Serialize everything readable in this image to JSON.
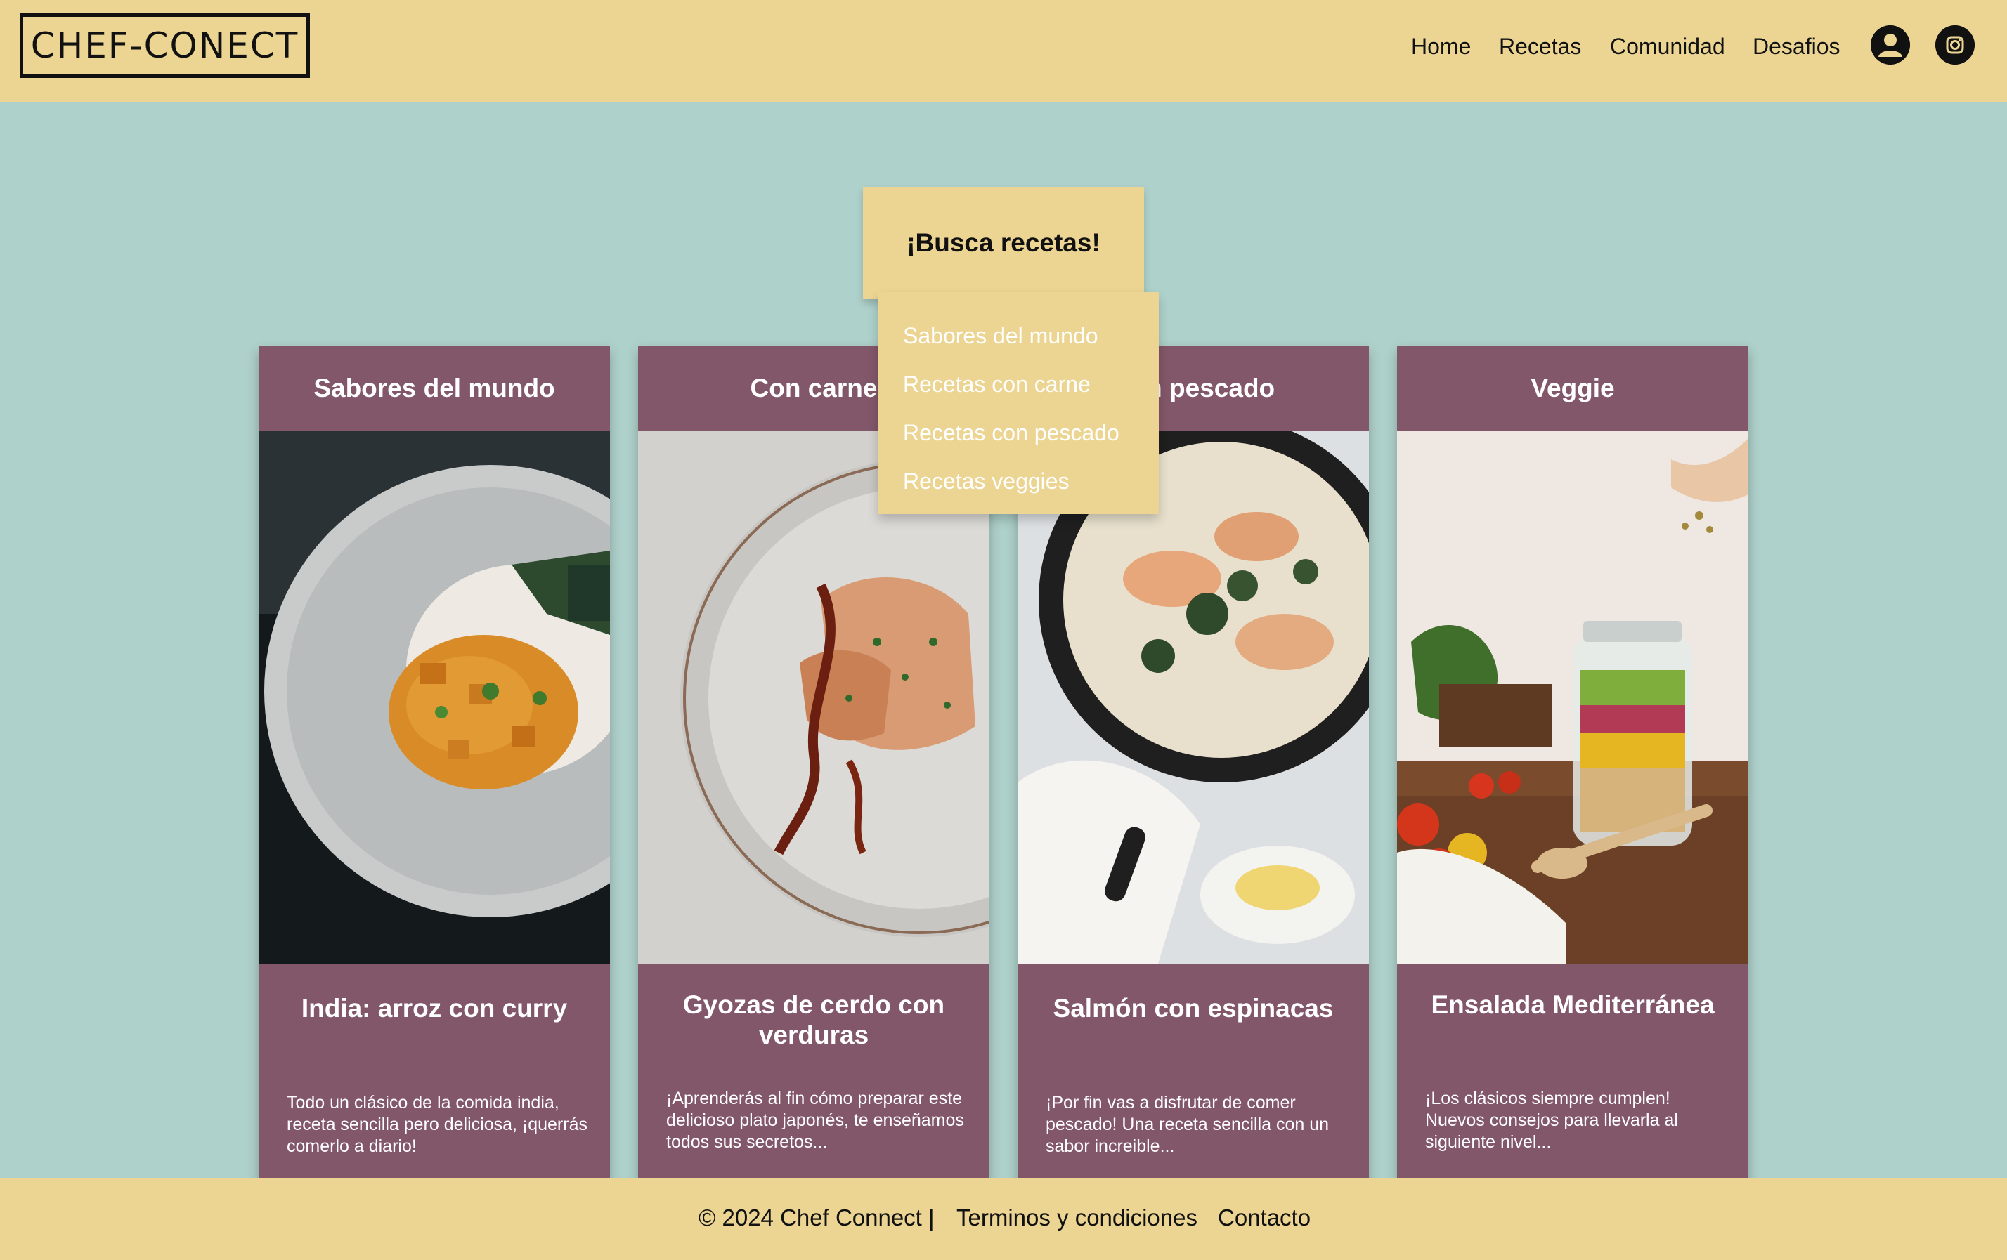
{
  "brand": {
    "logo_text": "CHEF-CONECT"
  },
  "nav": {
    "links": [
      "Home",
      "Recetas",
      "Comunidad",
      "Desafios"
    ],
    "icons": [
      "user-profile-icon",
      "instagram-icon"
    ]
  },
  "search": {
    "button_label": "¡Busca recetas!",
    "dropdown_items": [
      "Sabores del mundo",
      "Recetas con carne",
      "Recetas con pescado",
      "Recetas veggies"
    ]
  },
  "cards": [
    {
      "category": "Sabores del mundo",
      "title": "India: arroz con curry",
      "description": "Todo un clásico de la comida india, receta sencilla pero deliciosa, ¡querrás comerlo a diario!"
    },
    {
      "category": "Con carne",
      "title": "Gyozas de cerdo con verduras",
      "description": "¡Aprenderás al fin cómo preparar este delicioso plato japonés, te enseñamos todos sus secretos..."
    },
    {
      "category": "Con pescado",
      "title": "Salmón con espinacas",
      "description": "¡Por fin vas a disfrutar de comer pescado! Una receta sencilla con un sabor increible..."
    },
    {
      "category": "Veggie",
      "title": "Ensalada Mediterránea",
      "description": "¡Los clásicos siempre cumplen! Nuevos consejos para llevarla al siguiente nivel..."
    }
  ],
  "footer": {
    "copyright": "© 2024 Chef Connect |",
    "terms": "Terminos y condiciones",
    "contact": "Contacto"
  },
  "colors": {
    "page_background": "#afd1cb",
    "header_footer": "#ecd592",
    "card": "#83576a"
  }
}
